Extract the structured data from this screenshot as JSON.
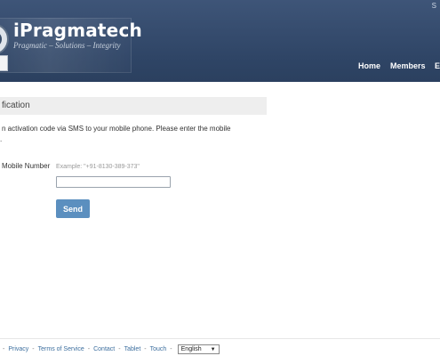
{
  "header": {
    "top_link": "S",
    "brand_title": "iPragmatech",
    "brand_tagline": "Pragmatic – Solutions – Integrity",
    "nav": {
      "home": "Home",
      "members": "Members",
      "more": "E"
    }
  },
  "main": {
    "section_title": "fication",
    "intro_line1": "n activation code via SMS to your mobile phone. Please enter the mobile",
    "intro_line2": ".",
    "mobile_label": "Mobile Number",
    "mobile_hint": "Example: \"+91-8130-389-373\"",
    "mobile_value": "",
    "send_label": "Send"
  },
  "footer": {
    "lead_sep": "-",
    "links": [
      "Privacy",
      "Terms of Service",
      "Contact",
      "Tablet",
      "Touch"
    ],
    "language": "English"
  },
  "colors": {
    "header": "#2f4566",
    "button": "#5b8fbf",
    "link": "#3c6e9e"
  }
}
